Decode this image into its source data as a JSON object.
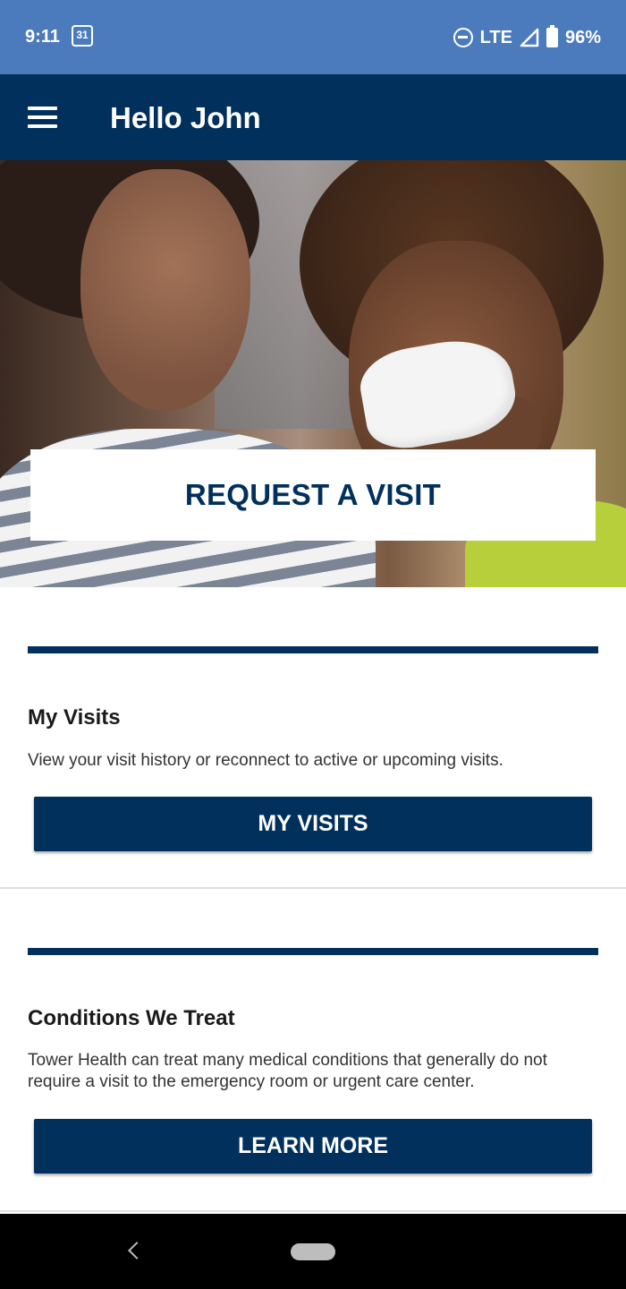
{
  "status_bar": {
    "time": "9:11",
    "calendar_day": "31",
    "network": "LTE",
    "battery": "96%"
  },
  "app_bar": {
    "title": "Hello John"
  },
  "hero": {
    "cta_label": "REQUEST A VISIT"
  },
  "visits": {
    "heading": "My Visits",
    "description": "View your visit history or reconnect to active or upcoming visits.",
    "button_label": "MY VISITS"
  },
  "conditions": {
    "heading": "Conditions We Treat",
    "description": "Tower Health can treat many medical conditions that generally do not require a visit to the emergency room or urgent care center.",
    "button_label": "LEARN MORE"
  },
  "colors": {
    "status_bar": "#4b7bbd",
    "brand_navy": "#00305b",
    "background": "#ffffff"
  },
  "icons": {
    "menu": "hamburger-menu-icon",
    "calendar": "calendar-icon",
    "dnd": "do-not-disturb-icon",
    "signal": "signal-icon",
    "battery": "battery-icon",
    "back": "back-icon",
    "home": "home-pill-icon"
  }
}
